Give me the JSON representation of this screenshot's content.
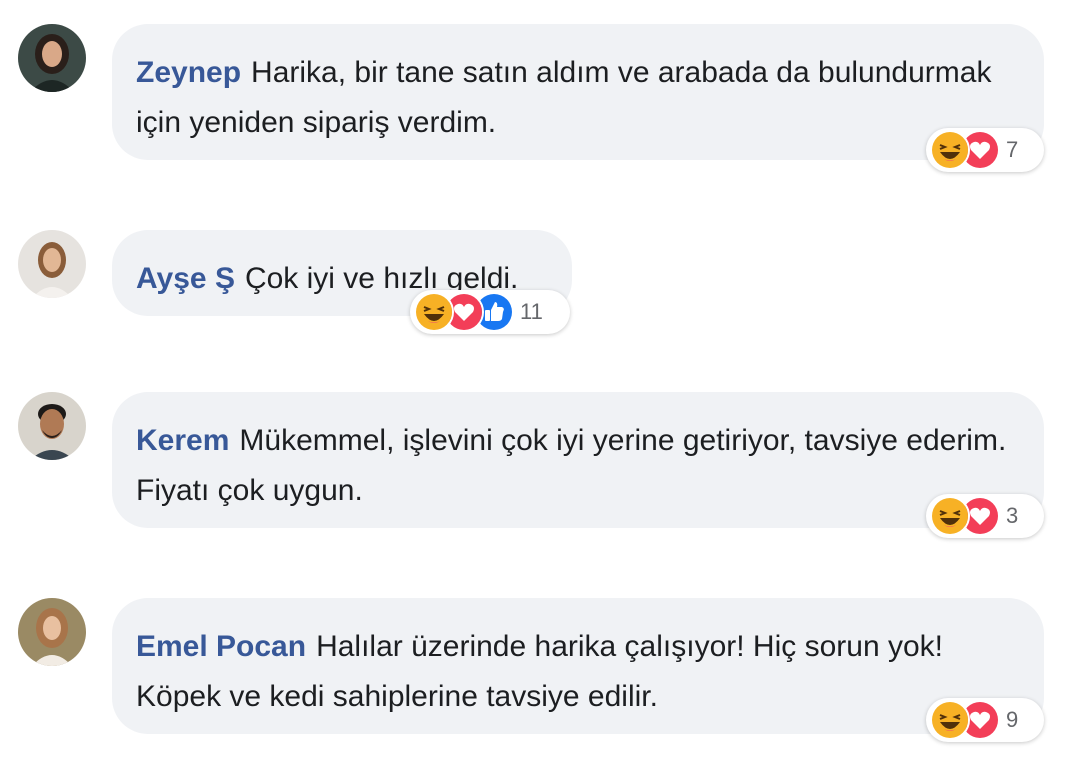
{
  "comments": [
    {
      "author": "Zeynep",
      "text": "Harika, bir tane satın aldım ve arabada da bulundurmak için yeniden sipariş verdim.",
      "reactions": [
        "haha-icon",
        "love-icon"
      ],
      "count": "7"
    },
    {
      "author": "Ayşe Ş",
      "text": "Çok iyi ve hızlı geldi.",
      "reactions": [
        "haha-icon",
        "love-icon",
        "like-icon"
      ],
      "count": "11"
    },
    {
      "author": "Kerem",
      "text": "Mükemmel, işlevini çok iyi yerine getiriyor, tavsiye ederim. Fiyatı çok uygun.",
      "reactions": [
        "haha-icon",
        "love-icon"
      ],
      "count": "3"
    },
    {
      "author": "Emel Pocan",
      "text": "Halılar üzerinde harika çalışıyor! Hiç sorun yok! Köpek ve kedi sahiplerine tavsiye edilir.",
      "reactions": [
        "haha-icon",
        "love-icon"
      ],
      "count": "9"
    }
  ],
  "colors": {
    "author": "#385898",
    "bubble": "#f0f2f5",
    "love": "#f33e58",
    "like": "#1877f2",
    "haha": "#f7b125"
  }
}
